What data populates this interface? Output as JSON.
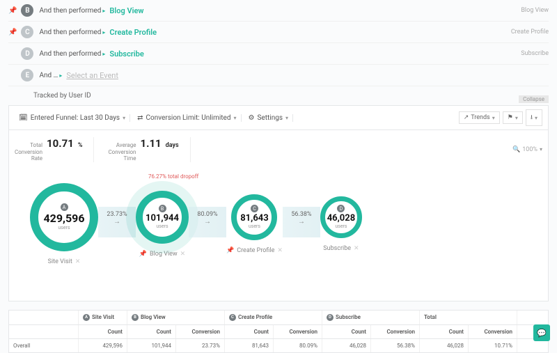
{
  "steps": [
    {
      "letter": "B",
      "prefix": "And then performed",
      "event": "Blog View",
      "pinned": true,
      "right": "Blog View"
    },
    {
      "letter": "C",
      "prefix": "And then performed",
      "event": "Create Profile",
      "pinned": true,
      "right": "Create Profile"
    },
    {
      "letter": "D",
      "prefix": "And then performed",
      "event": "Subscribe",
      "pinned": false,
      "right": "Subscribe"
    },
    {
      "letter": "E",
      "prefix": "And …",
      "placeholder": "Select an Event",
      "pinned": false,
      "right": ""
    }
  ],
  "tracked": "Tracked by User ID",
  "toolbar": {
    "entered": "Entered Funnel: Last 30 Days",
    "limit": "Conversion Limit: Unlimited",
    "settings": "Settings",
    "trends": "Trends",
    "collapse": "Collapse"
  },
  "metrics": {
    "rate_label": "Total\nConversion\nRate",
    "rate_val": "10.71",
    "rate_unit": "%",
    "time_label": "Average\nConversion\nTime",
    "time_val": "1.11",
    "time_unit": "days",
    "zoom": "100%"
  },
  "dropoff": "76.27% total dropoff",
  "nodes": [
    {
      "letter": "A",
      "value": "429,596",
      "label": "Site Visit",
      "pin": false
    },
    {
      "letter": "B",
      "value": "101,944",
      "label": "Blog View",
      "pin": true,
      "highlight": true
    },
    {
      "letter": "C",
      "value": "81,643",
      "label": "Create Profile",
      "pin": true
    },
    {
      "letter": "D",
      "value": "46,028",
      "label": "Subscribe",
      "pin": false
    }
  ],
  "flows": [
    {
      "pct": "23.73%"
    },
    {
      "pct": "80.09%"
    },
    {
      "pct": "56.38%"
    }
  ],
  "users_label": "users",
  "chart_data": {
    "type": "funnel",
    "title": "",
    "steps": [
      {
        "name": "Site Visit",
        "letter": "A",
        "count": 429596
      },
      {
        "name": "Blog View",
        "letter": "B",
        "count": 101944,
        "conversion_from_prev_pct": 23.73
      },
      {
        "name": "Create Profile",
        "letter": "C",
        "count": 81643,
        "conversion_from_prev_pct": 80.09
      },
      {
        "name": "Subscribe",
        "letter": "D",
        "count": 46028,
        "conversion_from_prev_pct": 56.38
      }
    ],
    "total_conversion_pct": 10.71,
    "avg_conversion_time_days": 1.11,
    "total_dropoff_pct": 76.27
  },
  "table": {
    "headers": [
      {
        "letter": "A",
        "name": "Site Visit"
      },
      {
        "letter": "B",
        "name": "Blog View"
      },
      {
        "letter": "C",
        "name": "Create Profile"
      },
      {
        "letter": "D",
        "name": "Subscribe"
      }
    ],
    "total_label": "Total",
    "count_label": "Count",
    "conv_label": "Conversion",
    "row_label": "Overall",
    "row": [
      "429,596",
      "101,944",
      "23.73%",
      "81,643",
      "80.09%",
      "46,028",
      "56.38%",
      "46,028",
      "10.71%"
    ]
  }
}
